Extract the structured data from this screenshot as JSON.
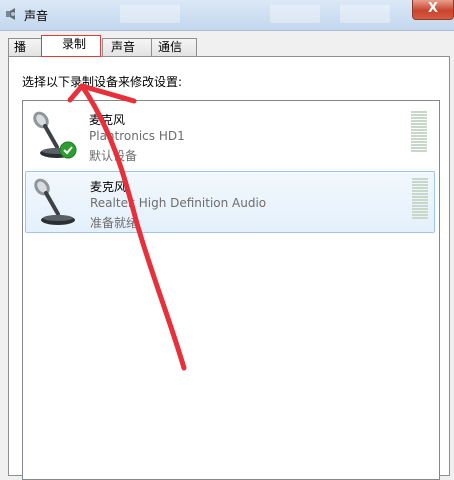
{
  "window": {
    "title": "声音",
    "close_glyph": "X",
    "background_titles": [
      "",
      "",
      ""
    ]
  },
  "tabs": [
    {
      "label": "播放",
      "active": false
    },
    {
      "label": "录制",
      "active": true
    },
    {
      "label": "声音",
      "active": false
    },
    {
      "label": "通信",
      "active": false
    }
  ],
  "recording": {
    "instruction": "选择以下录制设备来修改设置:",
    "devices": [
      {
        "name": "麦克风",
        "description": "Plantronics HD1",
        "status": "默认设备",
        "is_default": true,
        "selected": false
      },
      {
        "name": "麦克风",
        "description": "Realtek High Definition Audio",
        "status": "准备就绪",
        "is_default": false,
        "selected": true
      }
    ]
  },
  "icons": {
    "window": "speaker-icon",
    "device": "microphone-icon",
    "default_badge": "check-icon",
    "meter": "level-meter"
  },
  "colors": {
    "annotation_arrow": "#e8303a",
    "default_badge": "#2e9e32",
    "selection": "#e4f0fb",
    "close_button": "#c8452c"
  }
}
